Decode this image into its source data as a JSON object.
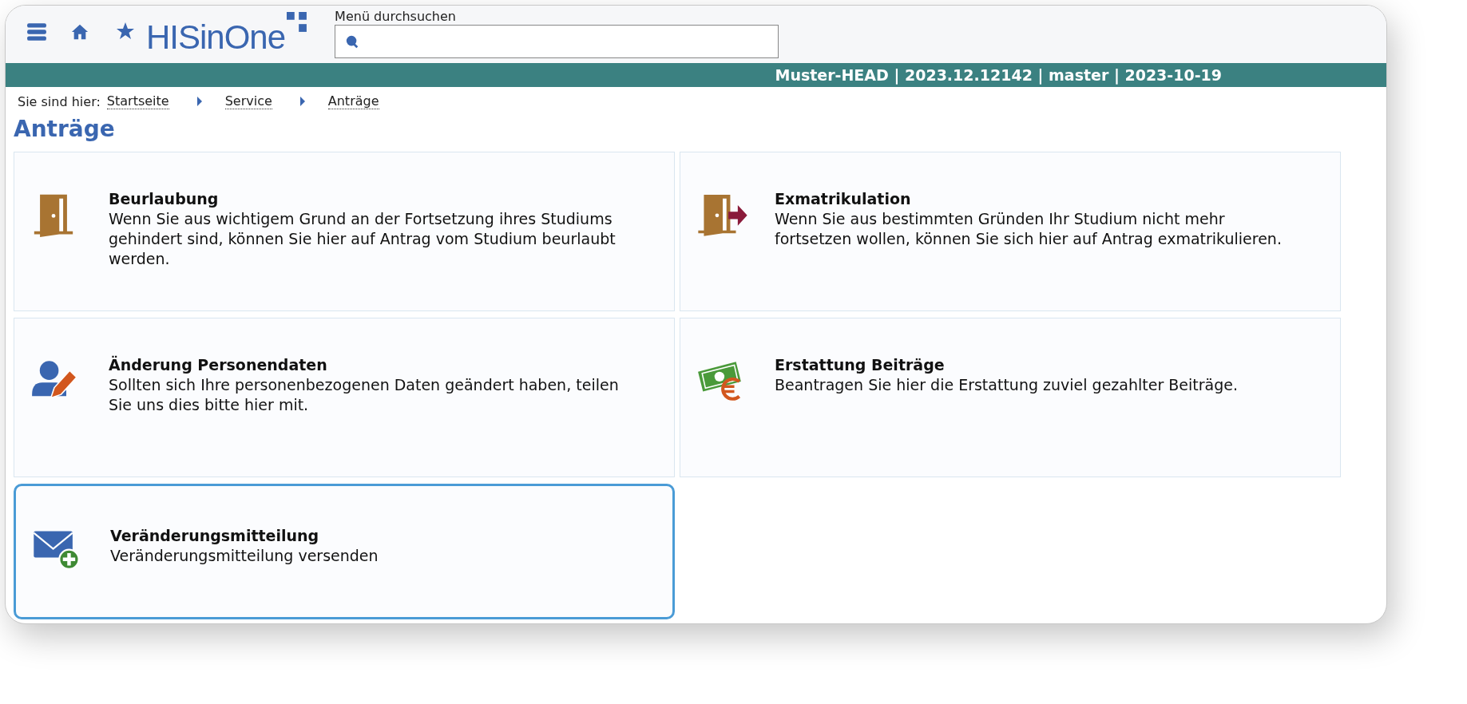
{
  "header": {
    "logo": "HISinOne",
    "search": {
      "label": "Menü durchsuchen"
    },
    "version_bar": "Muster-HEAD | 2023.12.12142 | master | 2023-10-19"
  },
  "breadcrumb": {
    "label": "Sie sind hier:",
    "items": [
      "Startseite",
      "Service",
      "Anträge"
    ]
  },
  "page_title": "Anträge",
  "cards": [
    {
      "kind": "leave",
      "title": "Beurlaubung",
      "text": "Wenn Sie aus wichtigem Grund an der Fortsetzung ihres Studiums gehindert sind, können Sie hier auf Antrag vom Studium beurlaubt werden.",
      "selected": false
    },
    {
      "kind": "exit",
      "title": "Exmatrikulation",
      "text": "Wenn Sie aus bestimmten Gründen Ihr Studium nicht mehr fortsetzen wollen, können Sie sich hier auf Antrag exmatrikulieren.",
      "selected": false
    },
    {
      "kind": "personal",
      "title": "Änderung Personendaten",
      "text": "Sollten sich Ihre personenbezogenen Daten geändert haben, teilen Sie uns dies bitte hier mit.",
      "selected": false
    },
    {
      "kind": "refund",
      "title": "Erstattung Beiträge",
      "text": "Beantragen Sie hier die Erstattung zuviel gezahlter Beiträge.",
      "selected": false
    },
    {
      "kind": "notice",
      "title": "Veränderungsmitteilung",
      "text": "Veränderungsmitteilung versenden",
      "selected": true
    }
  ]
}
